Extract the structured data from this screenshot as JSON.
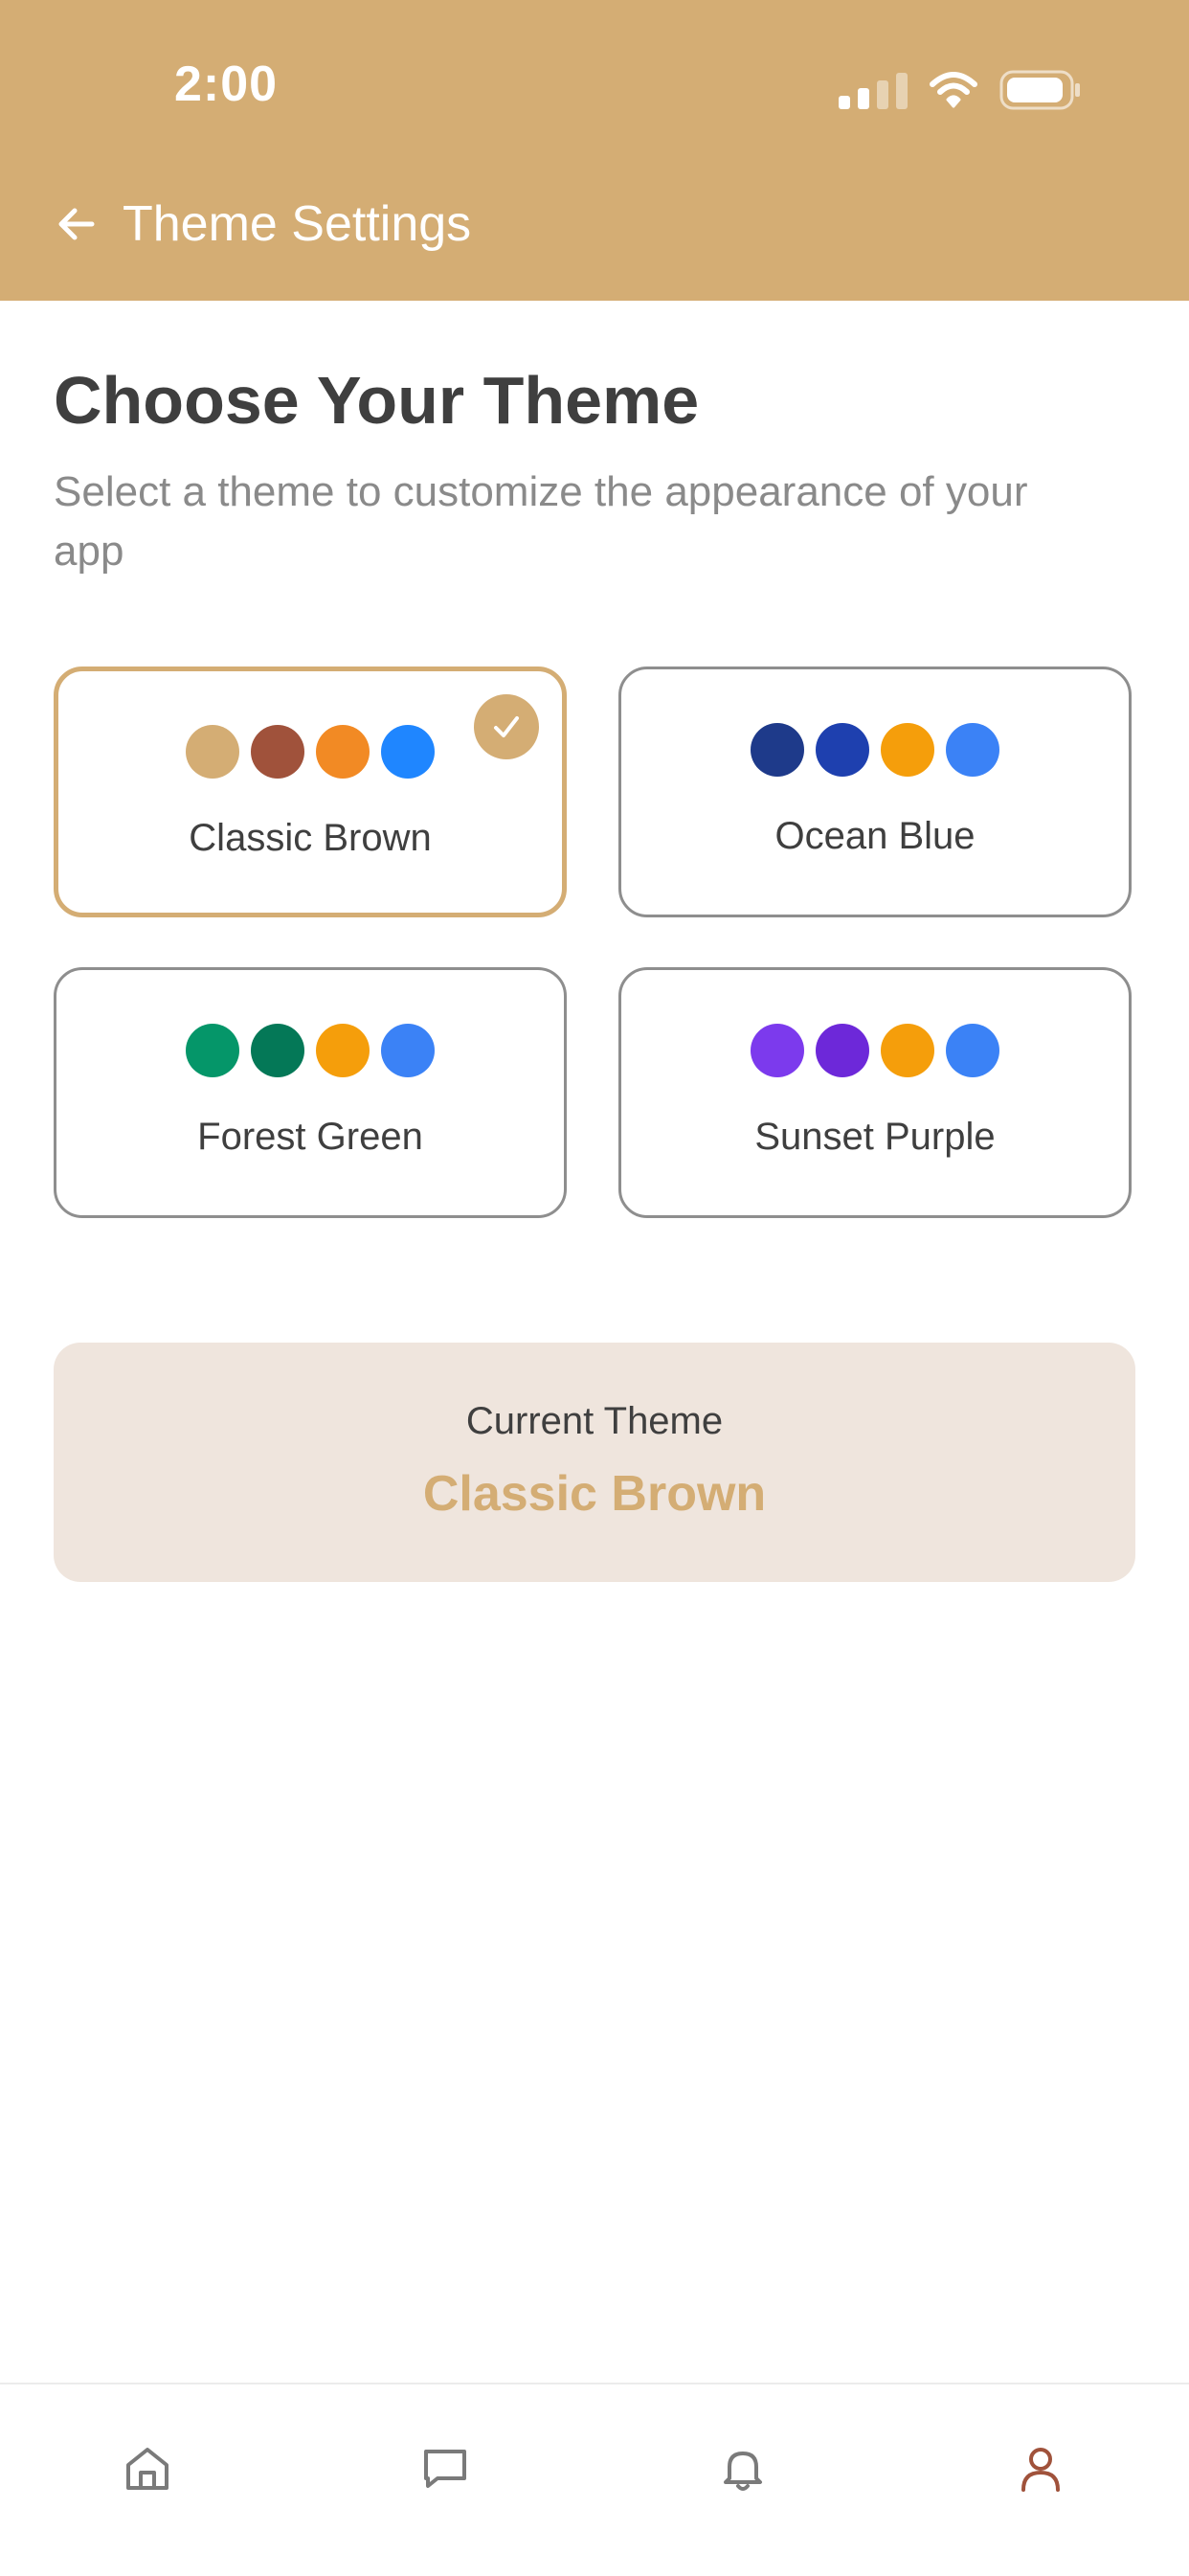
{
  "status_bar": {
    "time": "2:00"
  },
  "header": {
    "title": "Theme Settings",
    "back_icon": "arrow-left-icon"
  },
  "main": {
    "title": "Choose Your Theme",
    "subtitle": "Select a theme to customize the appearance of your app"
  },
  "themes": [
    {
      "name": "Classic Brown",
      "selected": true,
      "colors": [
        "#d4ad74",
        "#a0523b",
        "#f28a24",
        "#1f86ff"
      ]
    },
    {
      "name": "Ocean Blue",
      "selected": false,
      "colors": [
        "#1e3a8a",
        "#1e40af",
        "#f59e0b",
        "#3b82f6"
      ]
    },
    {
      "name": "Forest Green",
      "selected": false,
      "colors": [
        "#059669",
        "#047857",
        "#f59e0b",
        "#3b82f6"
      ]
    },
    {
      "name": "Sunset Purple",
      "selected": false,
      "colors": [
        "#7c3aed",
        "#6d28d9",
        "#f59e0b",
        "#3b82f6"
      ]
    }
  ],
  "current_theme": {
    "label": "Current Theme",
    "value": "Classic Brown"
  },
  "tabbar": {
    "items": [
      {
        "icon": "home-icon",
        "active": false
      },
      {
        "icon": "chat-icon",
        "active": false
      },
      {
        "icon": "bell-icon",
        "active": false
      },
      {
        "icon": "user-icon",
        "active": true
      }
    ]
  },
  "colors": {
    "header_bg": "#d4ad74",
    "accent": "#d4ad74",
    "active_tab": "#a0523b",
    "current_theme_bg": "#efe5dd"
  }
}
